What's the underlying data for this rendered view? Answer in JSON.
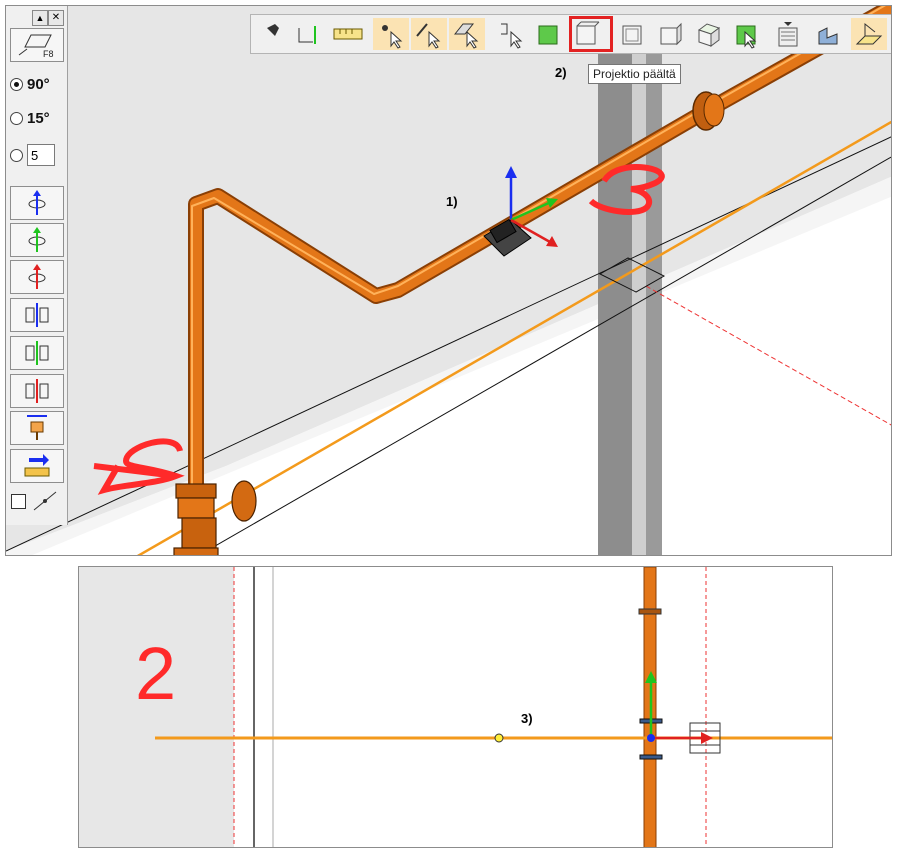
{
  "top_view": {
    "toolbar": {
      "tooltip": "Projektio päältä",
      "buttons": [
        "pin-icon",
        "rotate-pipe-icon",
        "measure-icon",
        "select-point-icon",
        "select-edge-icon",
        "select-face-icon",
        "select-bracket-icon",
        "view-solid-icon",
        "view-top-icon",
        "view-front-icon",
        "view-side-icon",
        "view-iso-icon",
        "view-select-icon",
        "layers-icon",
        "component-icon",
        "plane-icon"
      ]
    },
    "side": {
      "shortcut": "F8",
      "snap_90": "90°",
      "snap_15": "15°",
      "snap_custom_value": "5"
    },
    "annotations": {
      "a1": "1)",
      "a2": "2)",
      "big_2": "2",
      "big_3": "3"
    }
  },
  "bottom_view": {
    "annotations": {
      "a3": "3)",
      "big_2": "2"
    }
  },
  "colors": {
    "pipe": "#e07a1a",
    "pipe_dark": "#a84e08",
    "highlight": "#e32222",
    "marker": "#ff2a2a"
  }
}
